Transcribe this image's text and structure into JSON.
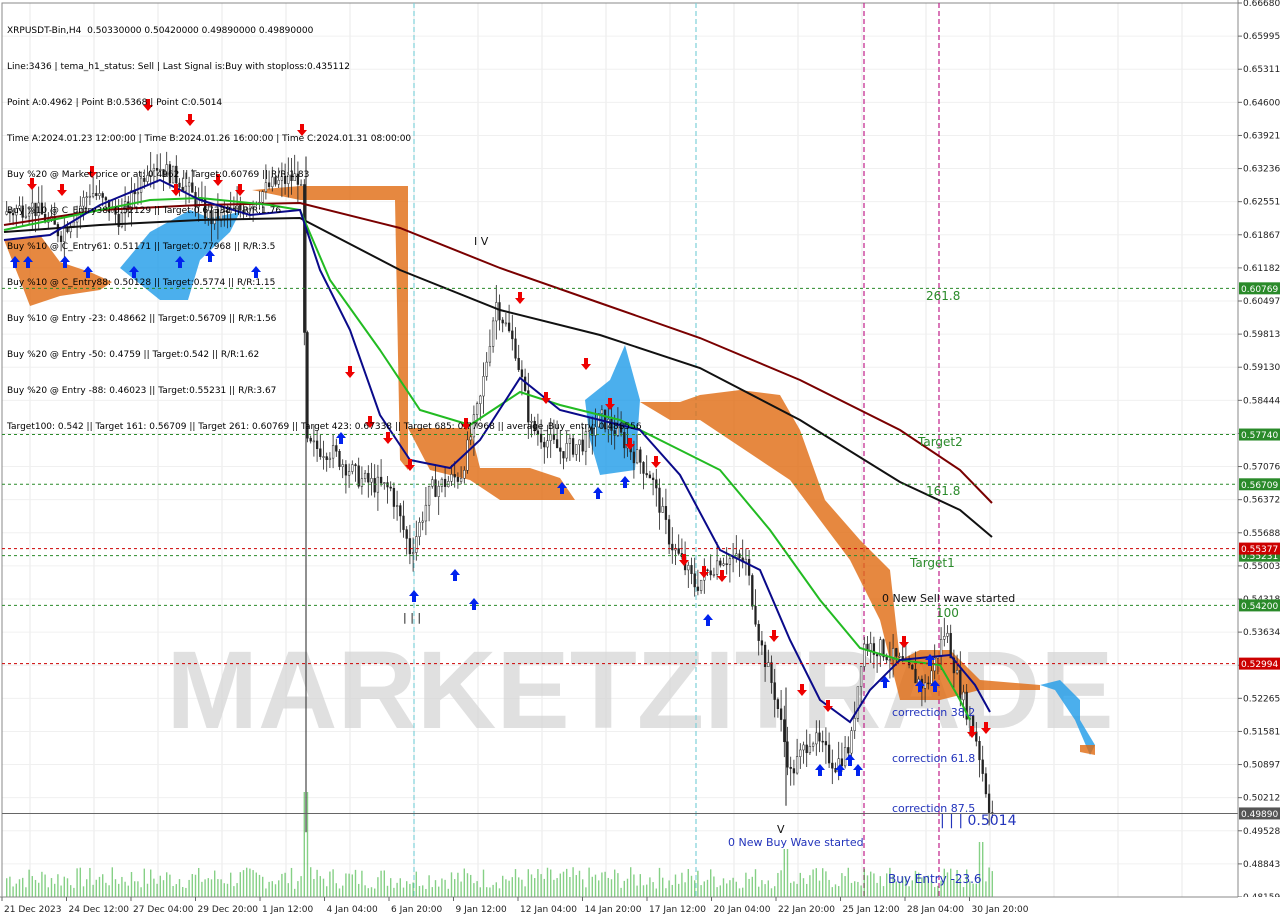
{
  "header": {
    "lines": [
      "XRPUSDT-Bin,H4  0.50330000 0.50420000 0.49890000 0.49890000",
      "Line:3436 | tema_h1_status: Sell | Last Signal is:Buy with stoploss:0.435112",
      "Point A:0.4962 | Point B:0.5368 | Point C:0.5014",
      "Time A:2024.01.23 12:00:00 | Time B:2024.01.26 16:00:00 | Time C:2024.01.31 08:00:00",
      "Buy %20 @ Market price or at: 0.4962 || Target:0.60769 || R/R:1.83",
      "Buy %10 @ C_Entry38: 0.52129 || Target:0.67338 || R/R:1.76",
      "Buy %10 @ C_Entry61: 0.51171 || Target:0.77968 || R/R:3.5",
      "Buy %10 @ C_Entry88: 0.50128 || Target:0.5774 || R/R:1.15",
      "Buy %10 @ Entry -23: 0.48662 || Target:0.56709 || R/R:1.56",
      "Buy %20 @ Entry -50: 0.4759 || Target:0.542 || R/R:1.62",
      "Buy %20 @ Entry -88: 0.46023 || Target:0.55231 || R/R:3.67",
      "Target100: 0.542 || Target 161: 0.56709 || Target 261: 0.60769 || Target 423: 0.67338 || Target 685: 0.77968 || average_Buy_entry: 0.488556"
    ]
  },
  "colors": {
    "buy_arrow": "#0022ee",
    "sell_arrow": "#ee0000",
    "cloud_orange": "#e06a10",
    "cloud_blue": "#1e9be8",
    "ma_black": "#111111",
    "ma_darkred": "#7a0000",
    "ma_green": "#22bb22",
    "ma_navy": "#0a0a8a",
    "level_green": "#2a8a2a",
    "level_red": "#cc0000",
    "vline_magenta": "#c0208a",
    "vline_cyan": "#7fd0d8",
    "watermark": "#d8d8d8"
  },
  "watermark": "MARKETZITRADE",
  "price_axis": {
    "ticks": [
      "0.66680",
      "0.65995",
      "0.65311",
      "0.64600",
      "0.63921",
      "0.63236",
      "0.62551",
      "0.61867",
      "0.61182",
      "0.60497",
      "0.59813",
      "0.59130",
      "0.58444",
      "0.57761",
      "0.57076",
      "0.56372",
      "0.55688",
      "0.55003",
      "0.54318",
      "0.53634",
      "0.52949",
      "0.52265",
      "0.51581",
      "0.50897",
      "0.50212",
      "0.49528",
      "0.48843",
      "0.48159"
    ],
    "badges": [
      {
        "label": "0.60769",
        "color": "#2a8a2a"
      },
      {
        "label": "0.57740",
        "color": "#2a8a2a"
      },
      {
        "label": "0.56709",
        "color": "#2a8a2a"
      },
      {
        "label": "0.55231",
        "color": "#2a8a2a"
      },
      {
        "label": "0.55377",
        "color": "#cc0000"
      },
      {
        "label": "0.54200",
        "color": "#2a8a2a"
      },
      {
        "label": "0.52994",
        "color": "#cc0000"
      },
      {
        "label": "0.49890",
        "color": "#555555"
      }
    ]
  },
  "time_axis": {
    "labels": [
      "21 Dec 2023",
      "24 Dec 12:00",
      "27 Dec 04:00",
      "29 Dec 20:00",
      "1 Jan 12:00",
      "4 Jan 04:00",
      "6 Jan 20:00",
      "9 Jan 12:00",
      "12 Jan 04:00",
      "14 Jan 20:00",
      "17 Jan 12:00",
      "20 Jan 04:00",
      "22 Jan 20:00",
      "25 Jan 12:00",
      "28 Jan 04:00",
      "30 Jan 20:00"
    ]
  },
  "level_labels": {
    "l261": "261.8",
    "target2": "Target2",
    "l161": "161.8",
    "target1": "Target1",
    "l100": "100",
    "sell_wave": "0 New Sell wave started",
    "corr382": "correction 38.2",
    "corr618": "correction 61.8",
    "corr875": "correction 87.5",
    "buy_wave": "0 New Buy Wave started",
    "buy_entry": "Buy Entry -23.6",
    "point_c": "| | | 0.5014",
    "wave_iii": "| | |",
    "wave_iv": "I V",
    "wave_v": "V"
  }
}
